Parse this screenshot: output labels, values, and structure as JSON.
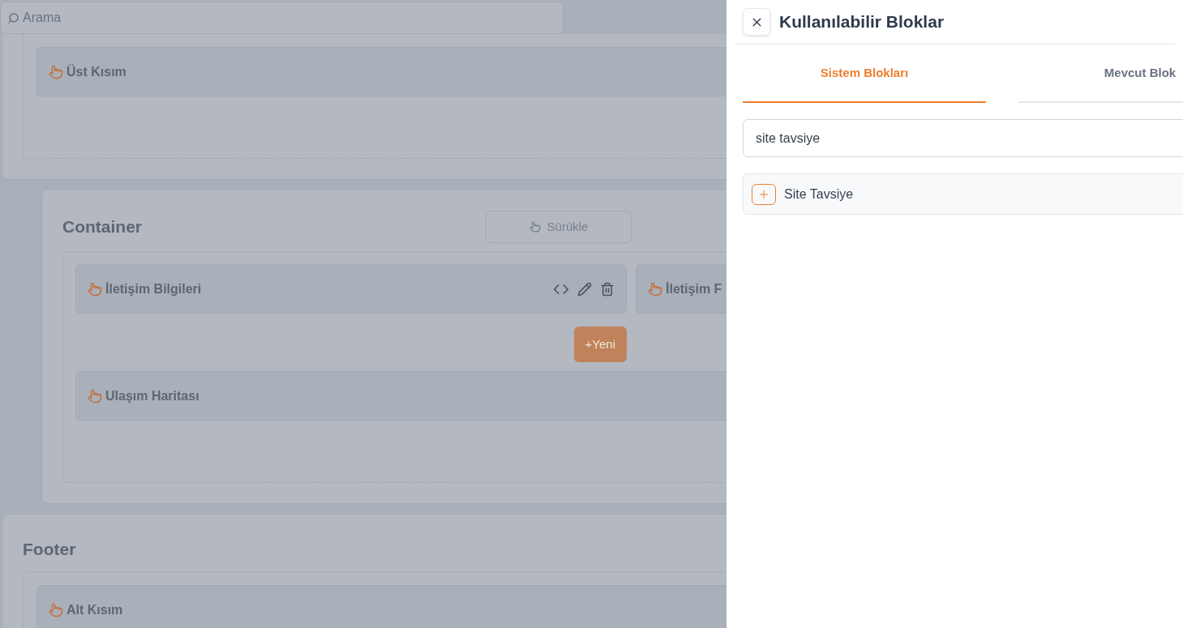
{
  "search": {
    "placeholder": "Arama"
  },
  "header_section": {
    "blocks": [
      {
        "label": "Üst Kısım"
      }
    ]
  },
  "container": {
    "title": "Container",
    "drag_button": "Sürükle",
    "new_button": "+Yeni",
    "blocks": [
      {
        "label": "İletişim Bilgileri",
        "kind": "actions"
      },
      {
        "label": "İletişim F",
        "kind": "plain"
      },
      {
        "label": "Ulaşım Haritası",
        "kind": "plain"
      }
    ]
  },
  "footer": {
    "title": "Footer",
    "blocks": [
      {
        "label": "Alt Kısım"
      }
    ]
  },
  "drawer": {
    "title": "Kullanılabilir Bloklar",
    "tabs": [
      {
        "label": "Sistem Blokları",
        "selected": true
      },
      {
        "label": "Mevcut Blok",
        "selected": false
      }
    ],
    "search": {
      "value": "site tavsiye"
    },
    "results": [
      {
        "label": "Site Tavsiye"
      }
    ]
  }
}
